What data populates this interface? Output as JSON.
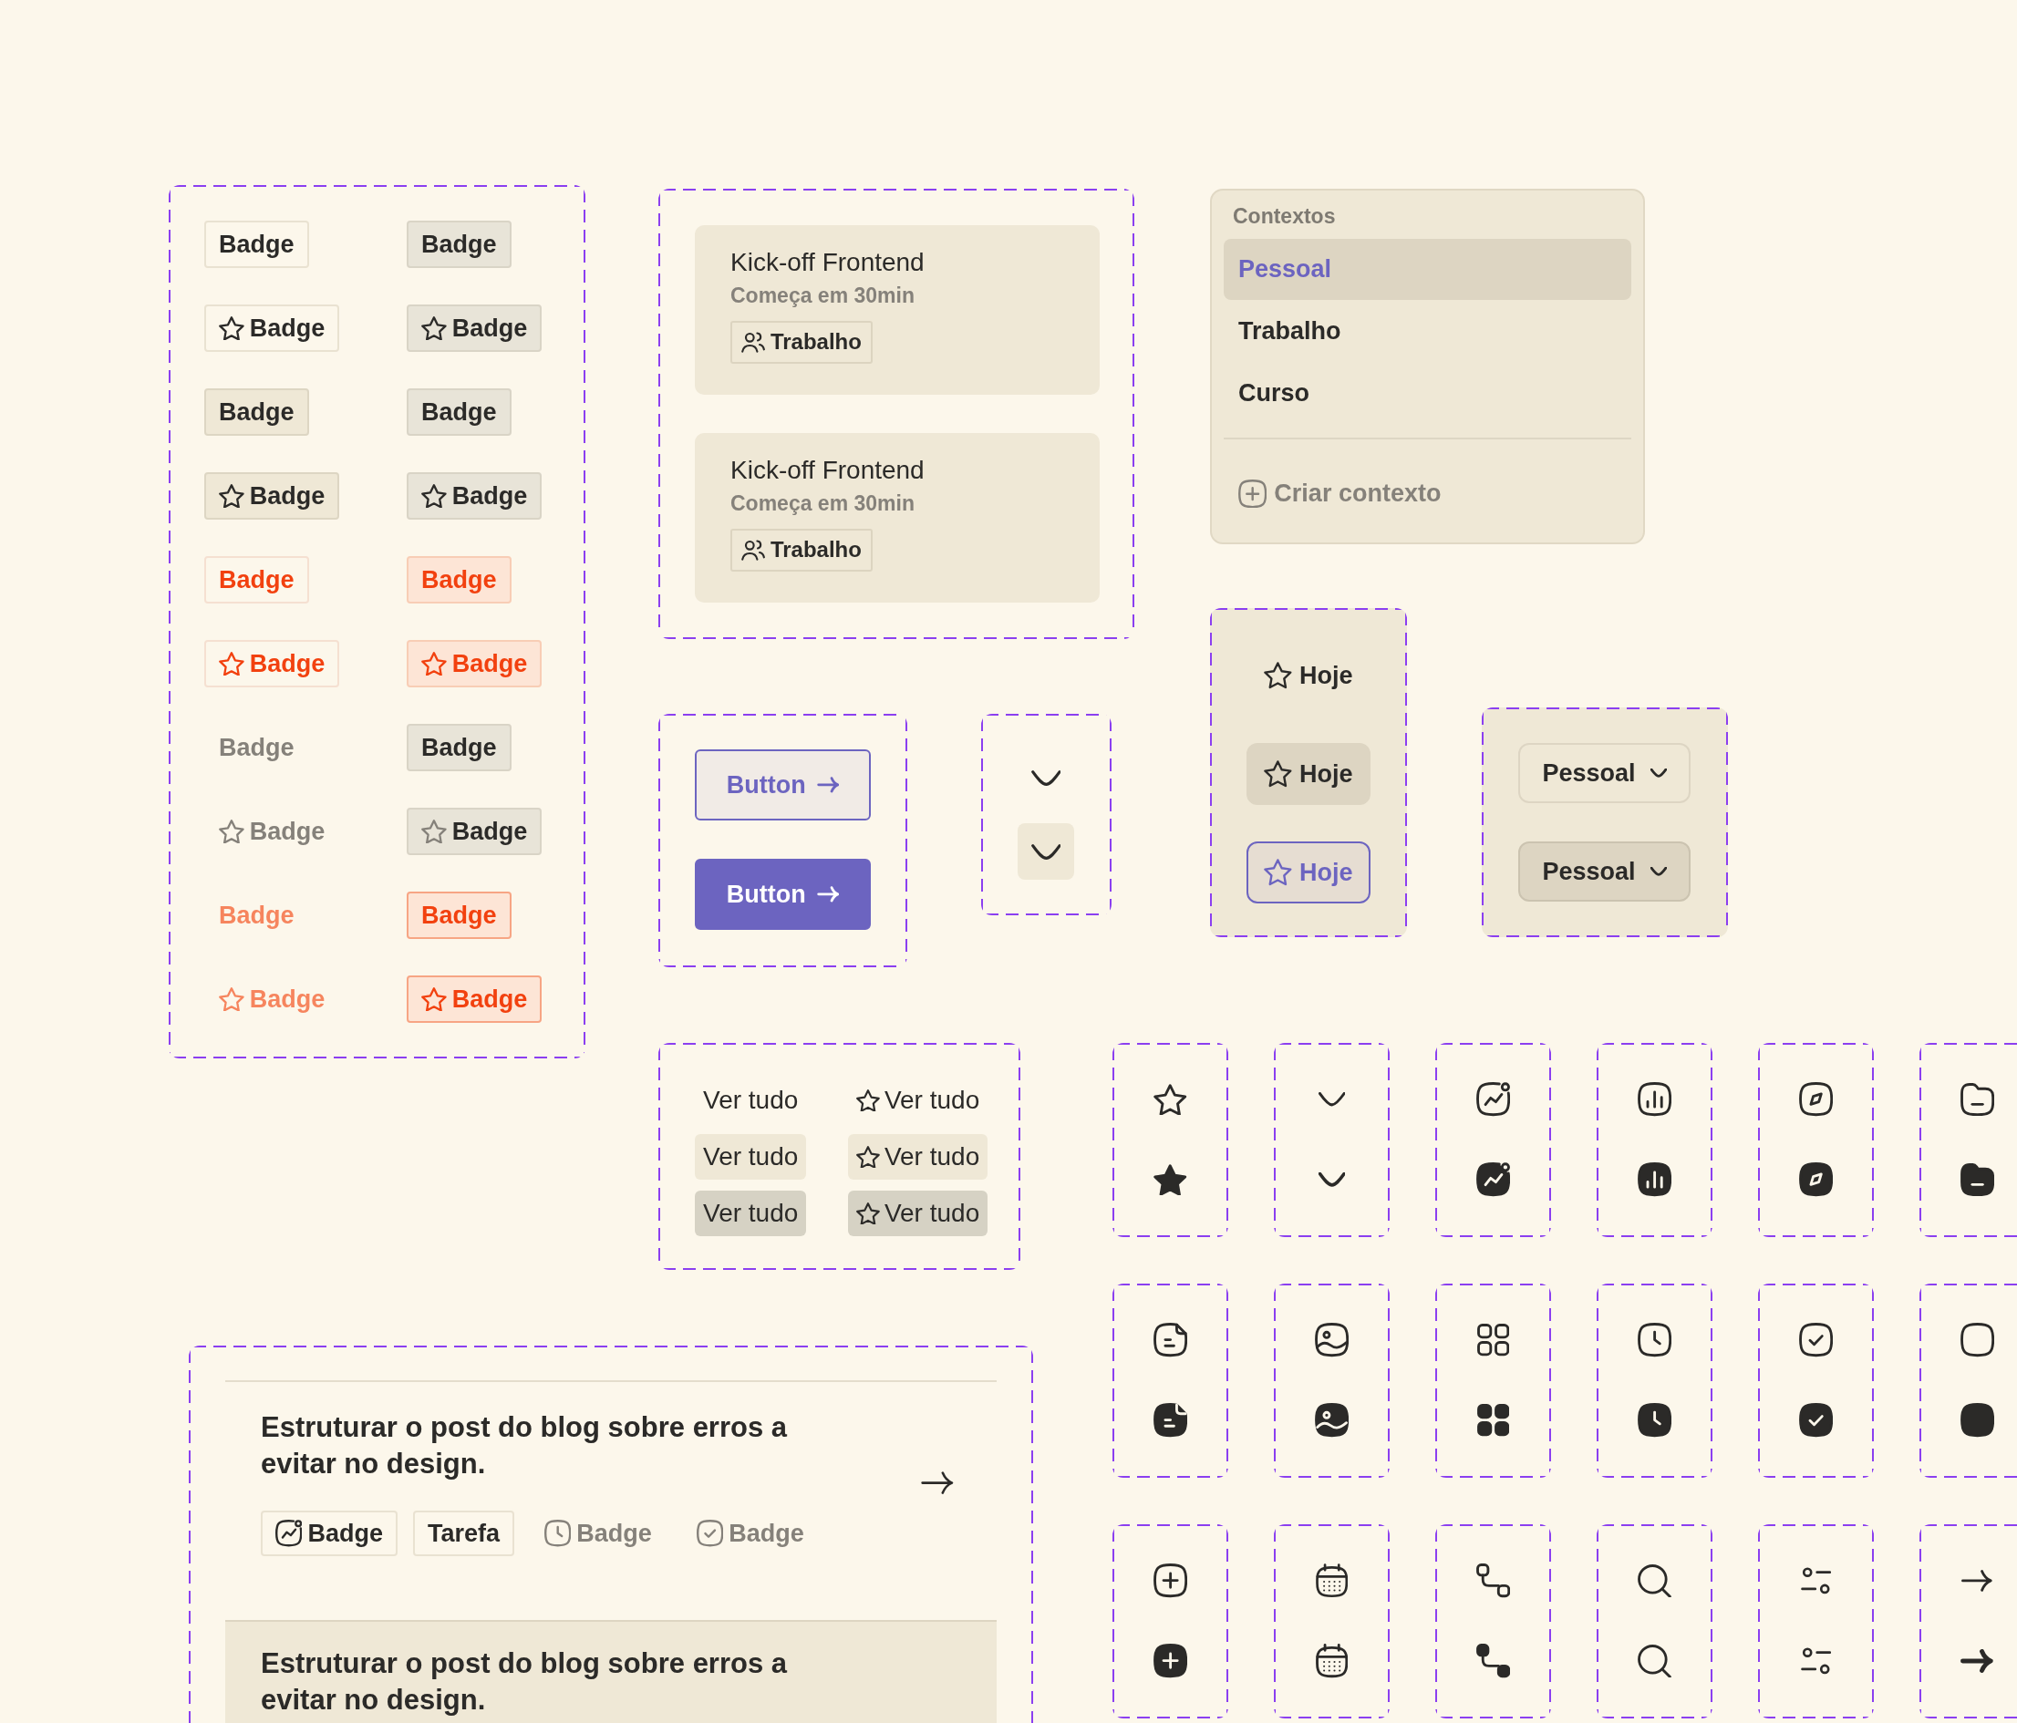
{
  "badge_panel": {
    "badges": [
      {
        "label": "Badge",
        "kind": "outline",
        "with_icon": false
      },
      {
        "label": "Badge",
        "kind": "neutral",
        "with_icon": false
      },
      {
        "label": "Badge",
        "kind": "outline",
        "with_icon": true
      },
      {
        "label": "Badge",
        "kind": "neutral",
        "with_icon": true
      },
      {
        "label": "Badge",
        "kind": "soft",
        "with_icon": false
      },
      {
        "label": "Badge",
        "kind": "neutral",
        "with_icon": false
      },
      {
        "label": "Badge",
        "kind": "soft",
        "with_icon": true
      },
      {
        "label": "Badge",
        "kind": "neutral",
        "with_icon": true
      },
      {
        "label": "Badge",
        "kind": "danger",
        "with_icon": false
      },
      {
        "label": "Badge",
        "kind": "blush",
        "with_icon": false
      },
      {
        "label": "Badge",
        "kind": "danger",
        "with_icon": true
      },
      {
        "label": "Badge",
        "kind": "blush",
        "with_icon": true
      },
      {
        "label": "Badge",
        "kind": "ghost",
        "with_icon": false
      },
      {
        "label": "Badge",
        "kind": "neutral",
        "with_icon": false
      },
      {
        "label": "Badge",
        "kind": "ghost",
        "with_icon": true
      },
      {
        "label": "Badge",
        "kind": "dim",
        "with_icon": true
      },
      {
        "label": "Badge",
        "kind": "coral",
        "with_icon": false
      },
      {
        "label": "Badge",
        "kind": "alert",
        "with_icon": false
      },
      {
        "label": "Badge",
        "kind": "coral",
        "with_icon": true
      },
      {
        "label": "Badge",
        "kind": "alert",
        "with_icon": true
      }
    ]
  },
  "event_cards": [
    {
      "title": "Kick-off Frontend",
      "subtitle": "Começa em 30min",
      "tag": "Trabalho"
    },
    {
      "title": "Kick-off Frontend",
      "subtitle": "Começa em 30min",
      "tag": "Trabalho"
    }
  ],
  "context_menu": {
    "heading": "Contextos",
    "items": [
      {
        "label": "Pessoal",
        "selected": true
      },
      {
        "label": "Trabalho",
        "selected": false
      },
      {
        "label": "Curso",
        "selected": false
      }
    ],
    "action": "Criar contexto"
  },
  "buttons": [
    {
      "label": "Button",
      "kind": "outline"
    },
    {
      "label": "Button",
      "kind": "solid"
    }
  ],
  "icon_buttons": [
    {
      "kind": "plain"
    },
    {
      "kind": "filled"
    }
  ],
  "nav_items": [
    {
      "label": "Hoje",
      "kind": "plain"
    },
    {
      "label": "Hoje",
      "kind": "filled"
    },
    {
      "label": "Hoje",
      "kind": "focused"
    }
  ],
  "selects": [
    {
      "value": "Pessoal",
      "kind": "outline"
    },
    {
      "value": "Pessoal",
      "kind": "filled"
    }
  ],
  "links": [
    {
      "label": "Ver tudo",
      "kind": "plain",
      "with_icon": false
    },
    {
      "label": "Ver tudo",
      "kind": "plain",
      "with_icon": true
    },
    {
      "label": "Ver tudo",
      "kind": "soft",
      "with_icon": false
    },
    {
      "label": "Ver tudo",
      "kind": "soft",
      "with_icon": true
    },
    {
      "label": "Ver tudo",
      "kind": "muted",
      "with_icon": false
    },
    {
      "label": "Ver tudo",
      "kind": "muted",
      "with_icon": true
    }
  ],
  "task_list": {
    "items": [
      {
        "title": "Estruturar o post do blog sobre erros a evitar no design.",
        "selected": false,
        "with_arrow": true,
        "badges": [
          {
            "label": "Badge",
            "kind": "outline",
            "with_icon": true
          },
          {
            "label": "Tarefa",
            "kind": "outline",
            "with_icon": false
          },
          {
            "label": "Badge",
            "kind": "ghost",
            "with_icon": true
          },
          {
            "label": "Badge",
            "kind": "ghost",
            "with_icon": true
          }
        ]
      },
      {
        "title": "Estruturar o post do blog sobre erros a evitar no design.",
        "selected": true,
        "with_arrow": false
      }
    ]
  }
}
